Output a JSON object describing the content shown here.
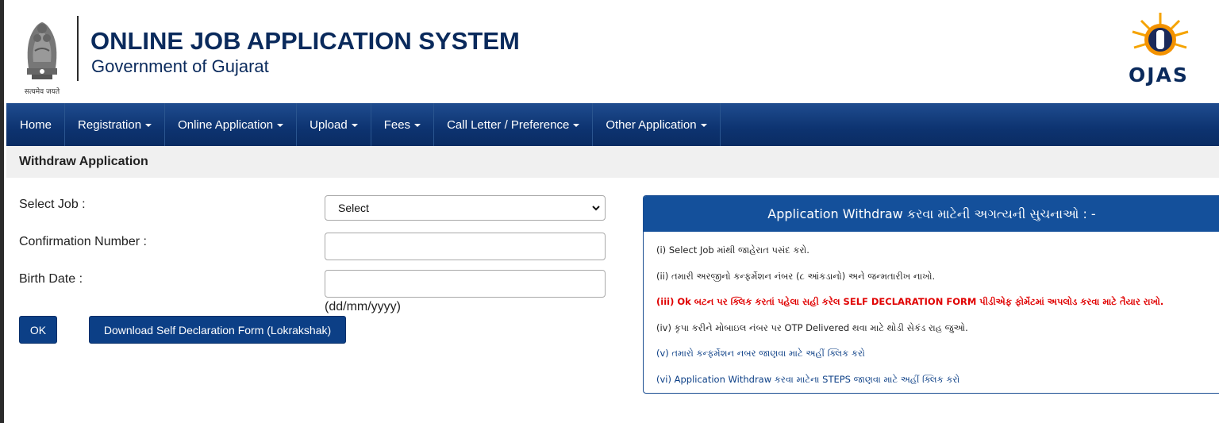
{
  "header": {
    "title": "ONLINE JOB APPLICATION SYSTEM",
    "subtitle": "Government of Gujarat",
    "emblem_caption": "सत्यमेव जयते",
    "logo_text": "OJAS"
  },
  "nav": {
    "items": [
      {
        "label": "Home",
        "dropdown": false
      },
      {
        "label": "Registration",
        "dropdown": true
      },
      {
        "label": "Online Application",
        "dropdown": true
      },
      {
        "label": "Upload",
        "dropdown": true
      },
      {
        "label": "Fees",
        "dropdown": true
      },
      {
        "label": "Call Letter / Preference",
        "dropdown": true
      },
      {
        "label": "Other Application",
        "dropdown": true
      }
    ]
  },
  "page": {
    "title": "Withdraw Application"
  },
  "form": {
    "select_job_label": "Select Job :",
    "select_job_value": "Select",
    "confirmation_label": "Confirmation Number :",
    "confirmation_value": "",
    "birth_date_label": "Birth Date :",
    "birth_date_value": "",
    "birth_date_hint": "(dd/mm/yyyy)",
    "ok_label": "OK",
    "download_label": "Download Self Declaration Form (Lokrakshak)"
  },
  "notice": {
    "heading": "Application Withdraw કરવા માટેની અગત્યની સુચનાઓ : -",
    "items": [
      {
        "text": "(i) Select Job માંથી જાહેરાત પસંદ કરો.",
        "style": "black"
      },
      {
        "text": "(ii) તમારી અરજીનો કન્ફર્મેશન નંબર (૮ આંકડાનો) અને જન્મતારીખ નાખો.",
        "style": "black"
      },
      {
        "text": "(iii) Ok બટન પર ક્લિક કરતાં પહેલા સહી કરેલ SELF DECLARATION FORM પીડીએફ ફોર્મેટમાં અપલોડ કરવા માટે તૈયાર રાખો.",
        "style": "red"
      },
      {
        "text": "(iv) કૃપા કરીને મોબાઇલ નંબર પર OTP Delivered થવા માટે થોડી સેકંડ રાહ જુઓ.",
        "style": "black"
      },
      {
        "text": "(v) તમારો કન્ફર્મેશન નબર જાણવા માટે અહીં ક્લિક કરો",
        "style": "blue"
      },
      {
        "text": "(vi) Application Withdraw કરવા માટેના STEPS જાણવા માટે અહીં ક્લિક કરો",
        "style": "blue"
      }
    ]
  },
  "colors": {
    "nav_bg": "#0d3370",
    "button_bg": "#0c3f86",
    "notice_head_bg": "#14509b",
    "alert_red": "#e00000"
  }
}
